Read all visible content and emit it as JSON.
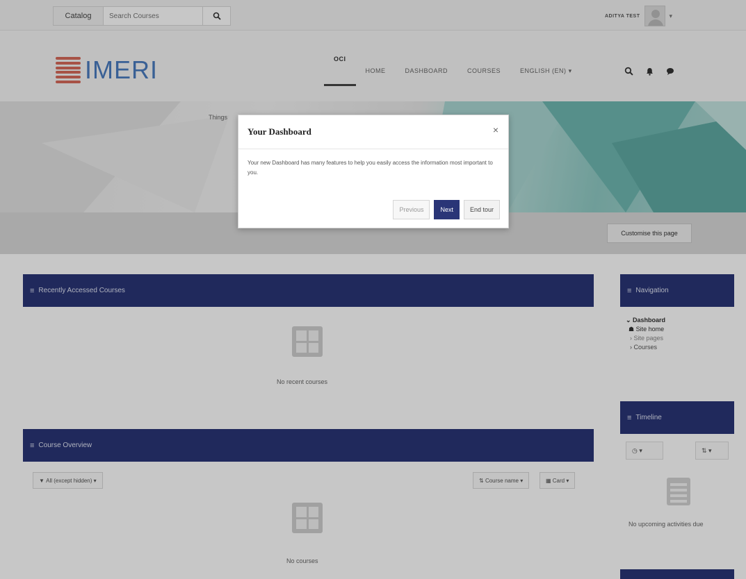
{
  "topbar": {
    "catalog_label": "Catalog",
    "search_placeholder": "Search Courses",
    "user_name": "ADITYA TEST"
  },
  "header": {
    "logo_text": "IMERI",
    "nav_items": [
      "OCI",
      "HOME",
      "DASHBOARD",
      "COURSES",
      "ENGLISH (EN)"
    ]
  },
  "banner": {
    "text": "Things",
    "customise_label": "Customise this page"
  },
  "recent": {
    "title": "Recently Accessed Courses",
    "empty_text": "No recent courses"
  },
  "overview": {
    "title": "Course Overview",
    "filter_label": "All (except hidden)",
    "sort_label": "Course name",
    "view_label": "Card",
    "empty_text": "No courses"
  },
  "sidebar": {
    "navigation_title": "Navigation",
    "tree": {
      "root": "Dashboard",
      "site_home": "Site home",
      "site_pages": "Site pages",
      "courses": "Courses"
    },
    "timeline_title": "Timeline",
    "timeline_empty": "No upcoming activities due"
  },
  "modal": {
    "title": "Your Dashboard",
    "body": "Your new Dashboard has many features to help you easily access the information most important to you.",
    "previous_label": "Previous",
    "next_label": "Next",
    "end_label": "End tour"
  },
  "colors": {
    "navy": "#2a3577",
    "banner_teal": "#8fcac4",
    "logo_blue": "#4a7bbf"
  }
}
